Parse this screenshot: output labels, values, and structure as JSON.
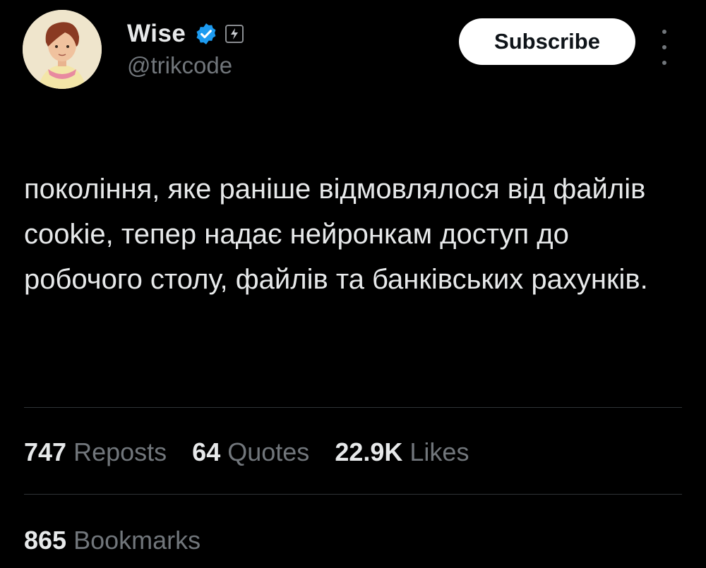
{
  "author": {
    "name": "Wise",
    "handle": "@trikcode"
  },
  "actions": {
    "subscribe_label": "Subscribe"
  },
  "tweet": {
    "text": "покоління, яке раніше відмовлялося від файлів cookie, тепер надає нейронкам доступ до робочого столу, файлів та банківських рахунків."
  },
  "stats": {
    "reposts": {
      "count": "747",
      "label": "Reposts"
    },
    "quotes": {
      "count": "64",
      "label": "Quotes"
    },
    "likes": {
      "count": "22.9K",
      "label": "Likes"
    },
    "bookmarks": {
      "count": "865",
      "label": "Bookmarks"
    }
  },
  "colors": {
    "background": "#000000",
    "text": "#e7e9ea",
    "muted": "#71767b",
    "verified": "#1d9bf0",
    "divider": "#2f3336"
  },
  "icons": [
    "avatar-illustration",
    "verified-badge-icon",
    "lightning-badge-icon",
    "more-options-icon"
  ]
}
